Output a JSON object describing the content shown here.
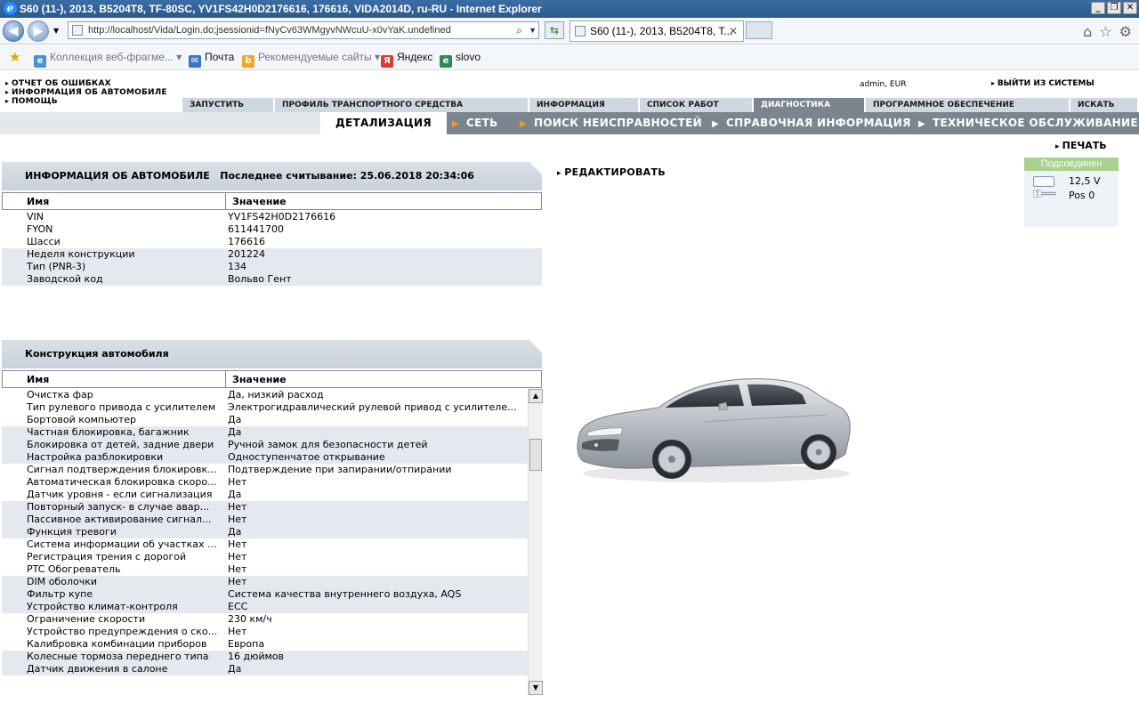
{
  "window": {
    "title": "S60 (11-), 2013, B5204T8, TF-80SC, YV1FS42H0D2176616, 176616, VIDA2014D, ru-RU - Internet Explorer",
    "buttons": [
      "_",
      "❐",
      "✕"
    ]
  },
  "browser": {
    "url": "http://localhost/Vida/Login.do;jsessionid=fNyCv63WMgyvNWcuU-x0vYaK.undefined",
    "tab_title": "S60 (11-), 2013, B5204T8, T...",
    "favorites": [
      {
        "label": "Коллекция веб-фрагме...",
        "icon": "ie-page-icon",
        "color": "#4a90d9"
      },
      {
        "label": "Почта",
        "icon": "mail-icon",
        "color": "#3a74c4"
      },
      {
        "label": "Рекомендуемые сайты",
        "icon": "bing-icon",
        "color": "#f5a623"
      },
      {
        "label": "Яндекс",
        "icon": "yandex-icon",
        "color": "#e23b2e"
      },
      {
        "label": "slovo",
        "icon": "ie-page-icon",
        "color": "#2e8b57"
      }
    ]
  },
  "vida": {
    "top_menu": [
      "ОТЧЕТ ОБ ОШИБКАХ",
      "ИНФОРМАЦИЯ ОБ АВТОМОБИЛЕ",
      "ПОМОЩЬ"
    ],
    "user_info": "admin, EUR",
    "logout": "ВЫЙТИ ИЗ СИСТЕМЫ",
    "main_tabs": [
      "ЗАПУСТИТЬ",
      "ПРОФИЛЬ ТРАНСПОРТНОГО СРЕДСТВА",
      "ИНФОРМАЦИЯ",
      "СПИСОК РАБОТ",
      "ДИАГНОСТИКА",
      "ПРОГРАММНОЕ ОБЕСПЕЧЕНИЕ",
      "ИСКАТЬ"
    ],
    "active_main_tab": "ДИАГНОСТИКА",
    "sub_tabs": [
      "ДЕТАЛИЗАЦИЯ",
      "СЕТЬ",
      "ПОИСК НЕИСПРАВНОСТЕЙ",
      "СПРАВОЧНАЯ ИНФОРМАЦИЯ",
      "ТЕХНИЧЕСКОЕ ОБСЛУЖИВАНИЕ"
    ],
    "print": "ПЕЧАТЬ",
    "edit": "РЕДАКТИРОВАТЬ",
    "status": {
      "header": "Подсоединен",
      "voltage": "12,5 V",
      "ignition": "Pos 0",
      "header_color": "#a9d18e"
    }
  },
  "vehicle_info": {
    "title": "ИНФОРМАЦИЯ ОБ АВТОМОБИЛЕ",
    "last_read": "Последнее считывание: 25.06.2018 20:34:06",
    "col_name": "Имя",
    "col_value": "Значение",
    "rows": [
      {
        "k": "VIN",
        "v": "YV1FS42H0D2176616"
      },
      {
        "k": "FYON",
        "v": "611441700"
      },
      {
        "k": "Шасси",
        "v": "176616"
      },
      {
        "k": "Неделя конструкции",
        "v": "201224"
      },
      {
        "k": "Тип (PNR-3)",
        "v": "134"
      },
      {
        "k": "Заводской код",
        "v": "Вольво Гент"
      }
    ]
  },
  "construction": {
    "title": "Конструкция автомобиля",
    "col_name": "Имя",
    "col_value": "Значение",
    "rows": [
      {
        "k": "Очистка фар",
        "v": "Да, низкий расход"
      },
      {
        "k": "Тип рулевого привода с усилителем",
        "v": "Электрогидравлический рулевой привод с усилителе..."
      },
      {
        "k": "Бортовой компьютер",
        "v": "Да"
      },
      {
        "k": "Частная блокировка, багажник",
        "v": "Да"
      },
      {
        "k": "Блокировка от детей, задние двери",
        "v": "Ручной замок для безопасности детей"
      },
      {
        "k": "Настройка разблокировки",
        "v": "Одноступенчатое открывание"
      },
      {
        "k": "Сигнал подтверждения блокировк...",
        "v": "Подтверждение при запирании/отпирании"
      },
      {
        "k": "Автоматическая блокировка скоро...",
        "v": "Нет"
      },
      {
        "k": "Датчик уровня - если сигнализация",
        "v": "Да"
      },
      {
        "k": "Повторный запуск- в случае авар...",
        "v": "Нет"
      },
      {
        "k": "Пассивное активирование сигнал...",
        "v": "Нет"
      },
      {
        "k": "Функция тревоги",
        "v": "Да"
      },
      {
        "k": "Система информации об участках ...",
        "v": "Нет"
      },
      {
        "k": "Регистрация трения с дорогой",
        "v": "Нет"
      },
      {
        "k": "PTC Обогреватель",
        "v": "Нет"
      },
      {
        "k": "DIM оболочки",
        "v": "Нет"
      },
      {
        "k": "Фильтр купе",
        "v": "Система качества внутреннего воздуха, AQS"
      },
      {
        "k": "Устройство климат-контроля",
        "v": "ECC"
      },
      {
        "k": "Ограничение скорости",
        "v": "230 км/ч"
      },
      {
        "k": "Устройство предупреждения о ско...",
        "v": "Нет"
      },
      {
        "k": "Калибровка комбинации приборов",
        "v": "Европа"
      },
      {
        "k": "Колесные тормоза переднего типа",
        "v": "16 дюймов"
      },
      {
        "k": "Датчик движения в салоне",
        "v": "Да"
      }
    ]
  }
}
